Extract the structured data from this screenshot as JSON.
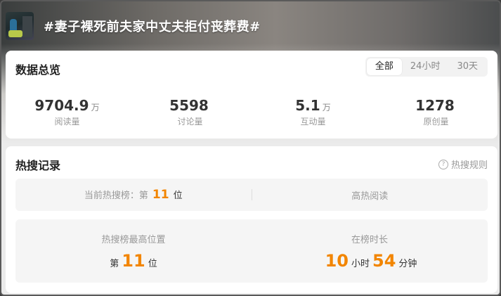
{
  "header": {
    "title": "#妻子裸死前夫家中丈夫拒付丧葬费#"
  },
  "overview": {
    "title": "数据总览",
    "tabs": [
      "全部",
      "24小时",
      "30天"
    ],
    "stats": [
      {
        "value": "9704.9",
        "unit": "万",
        "label": "阅读量"
      },
      {
        "value": "5598",
        "unit": "",
        "label": "讨论量"
      },
      {
        "value": "5.1",
        "unit": "万",
        "label": "互动量"
      },
      {
        "value": "1278",
        "unit": "",
        "label": "原创量"
      }
    ]
  },
  "hot": {
    "title": "热搜记录",
    "rules_label": "热搜规则",
    "current_prefix": "当前热搜榜：第",
    "current_rank": "11",
    "current_suffix": "位",
    "hot_read_label": "高热阅读",
    "best_position_label": "热搜榜最高位置",
    "best_prefix": "第",
    "best_rank": "11",
    "best_suffix": "位",
    "duration_label": "在榜时长",
    "hours": "10",
    "hours_unit": "小时",
    "minutes": "54",
    "minutes_unit": "分钟"
  },
  "icons": {
    "help": "question-circle-icon",
    "thumbnail": "topic-thumbnail"
  },
  "colors": {
    "accent": "#f28500"
  }
}
